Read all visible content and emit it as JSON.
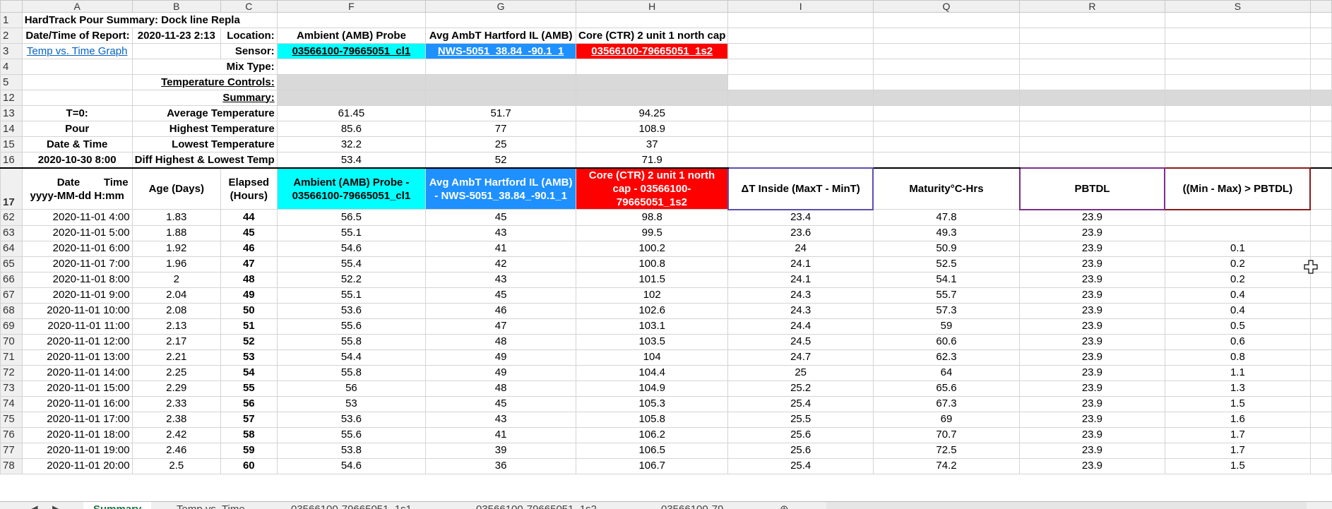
{
  "col_letters": [
    "A",
    "B",
    "C",
    "F",
    "G",
    "H",
    "I",
    "Q",
    "R",
    "S"
  ],
  "title": "HardTrack Pour Summary: Dock line Repla",
  "meta": {
    "date_label": "Date/Time of Report:",
    "date_value": "2020-11-23 2:13",
    "location_label": "Location:",
    "graph_link": "Temp vs. Time Graph",
    "sensor_label": "Sensor:",
    "mix_label": "Mix Type:",
    "controls_label": "Temperature Controls:",
    "summary_label": "Summary:"
  },
  "locations": [
    "Ambient (AMB) Probe",
    "Avg AmbT Hartford IL (AMB)",
    "Core (CTR) 2 unit 1 north cap"
  ],
  "sensors": [
    "03566100-79665051_cl1",
    "NWS-5051_38.84_-90.1_1",
    "03566100-79665051_1s2"
  ],
  "t0": [
    "T=0:",
    "Pour",
    "Date & Time",
    "2020-10-30 8:00"
  ],
  "stats": [
    {
      "label": "Average Temperature",
      "values": [
        "61.45",
        "51.7",
        "94.25"
      ]
    },
    {
      "label": "Highest Temperature",
      "values": [
        "85.6",
        "77",
        "108.9"
      ]
    },
    {
      "label": "Lowest Temperature",
      "values": [
        "32.2",
        "25",
        "37"
      ]
    },
    {
      "label": "Diff Highest & Lowest Temp",
      "values": [
        "53.4",
        "52",
        "71.9"
      ]
    }
  ],
  "header17": {
    "date_l1a": "Date",
    "date_l1b": "Time",
    "date_l2": "yyyy-MM-dd H:mm",
    "age": "Age (Days)",
    "elapsed": "Elapsed (Hours)",
    "f": "Ambient (AMB) Probe - 03566100-79665051_cl1",
    "g": "Avg AmbT Hartford IL (AMB) - NWS-5051_38.84_-90.1_1",
    "h": "Core (CTR) 2 unit 1 north cap - 03566100-79665051_1s2",
    "i": "ΔT Inside (MaxT - MinT)",
    "q": "Maturity°C-Hrs",
    "r": "PBTDL",
    "s": "((Min - Max) > PBTDL)"
  },
  "rows": [
    {
      "n": "62",
      "date": "2020-11-01 4:00",
      "age": "1.83",
      "el": "44",
      "f": "56.5",
      "g": "45",
      "h": "98.8",
      "i": "23.4",
      "q": "47.8",
      "r": "23.9",
      "s": ""
    },
    {
      "n": "63",
      "date": "2020-11-01 5:00",
      "age": "1.88",
      "el": "45",
      "f": "55.1",
      "g": "43",
      "h": "99.5",
      "i": "23.6",
      "q": "49.3",
      "r": "23.9",
      "s": ""
    },
    {
      "n": "64",
      "date": "2020-11-01 6:00",
      "age": "1.92",
      "el": "46",
      "f": "54.6",
      "g": "41",
      "h": "100.2",
      "i": "24",
      "q": "50.9",
      "r": "23.9",
      "s": "0.1"
    },
    {
      "n": "65",
      "date": "2020-11-01 7:00",
      "age": "1.96",
      "el": "47",
      "f": "55.4",
      "g": "42",
      "h": "100.8",
      "i": "24.1",
      "q": "52.5",
      "r": "23.9",
      "s": "0.2"
    },
    {
      "n": "66",
      "date": "2020-11-01 8:00",
      "age": "2",
      "el": "48",
      "f": "52.2",
      "g": "43",
      "h": "101.5",
      "i": "24.1",
      "q": "54.1",
      "r": "23.9",
      "s": "0.2"
    },
    {
      "n": "67",
      "date": "2020-11-01 9:00",
      "age": "2.04",
      "el": "49",
      "f": "55.1",
      "g": "45",
      "h": "102",
      "i": "24.3",
      "q": "55.7",
      "r": "23.9",
      "s": "0.4"
    },
    {
      "n": "68",
      "date": "2020-11-01 10:00",
      "age": "2.08",
      "el": "50",
      "f": "53.6",
      "g": "46",
      "h": "102.6",
      "i": "24.3",
      "q": "57.3",
      "r": "23.9",
      "s": "0.4"
    },
    {
      "n": "69",
      "date": "2020-11-01 11:00",
      "age": "2.13",
      "el": "51",
      "f": "55.6",
      "g": "47",
      "h": "103.1",
      "i": "24.4",
      "q": "59",
      "r": "23.9",
      "s": "0.5"
    },
    {
      "n": "70",
      "date": "2020-11-01 12:00",
      "age": "2.17",
      "el": "52",
      "f": "55.8",
      "g": "48",
      "h": "103.5",
      "i": "24.5",
      "q": "60.6",
      "r": "23.9",
      "s": "0.6"
    },
    {
      "n": "71",
      "date": "2020-11-01 13:00",
      "age": "2.21",
      "el": "53",
      "f": "54.4",
      "g": "49",
      "h": "104",
      "i": "24.7",
      "q": "62.3",
      "r": "23.9",
      "s": "0.8"
    },
    {
      "n": "72",
      "date": "2020-11-01 14:00",
      "age": "2.25",
      "el": "54",
      "f": "55.8",
      "g": "49",
      "h": "104.4",
      "i": "25",
      "q": "64",
      "r": "23.9",
      "s": "1.1"
    },
    {
      "n": "73",
      "date": "2020-11-01 15:00",
      "age": "2.29",
      "el": "55",
      "f": "56",
      "g": "48",
      "h": "104.9",
      "i": "25.2",
      "q": "65.6",
      "r": "23.9",
      "s": "1.3"
    },
    {
      "n": "74",
      "date": "2020-11-01 16:00",
      "age": "2.33",
      "el": "56",
      "f": "53",
      "g": "45",
      "h": "105.3",
      "i": "25.4",
      "q": "67.3",
      "r": "23.9",
      "s": "1.5"
    },
    {
      "n": "75",
      "date": "2020-11-01 17:00",
      "age": "2.38",
      "el": "57",
      "f": "53.6",
      "g": "43",
      "h": "105.8",
      "i": "25.5",
      "q": "69",
      "r": "23.9",
      "s": "1.6"
    },
    {
      "n": "76",
      "date": "2020-11-01 18:00",
      "age": "2.42",
      "el": "58",
      "f": "55.6",
      "g": "41",
      "h": "106.2",
      "i": "25.6",
      "q": "70.7",
      "r": "23.9",
      "s": "1.7"
    },
    {
      "n": "77",
      "date": "2020-11-01 19:00",
      "age": "2.46",
      "el": "59",
      "f": "53.8",
      "g": "39",
      "h": "106.5",
      "i": "25.6",
      "q": "72.5",
      "r": "23.9",
      "s": "1.7"
    },
    {
      "n": "78",
      "date": "2020-11-01 20:00",
      "age": "2.5",
      "el": "60",
      "f": "54.6",
      "g": "36",
      "h": "106.7",
      "i": "25.4",
      "q": "74.2",
      "r": "23.9",
      "s": "1.5"
    }
  ],
  "tabs": [
    "Summary",
    "Temp vs. Time",
    "03566100-79665051_1s1",
    "03566100-79665051_1s2",
    "03566100-79..."
  ]
}
